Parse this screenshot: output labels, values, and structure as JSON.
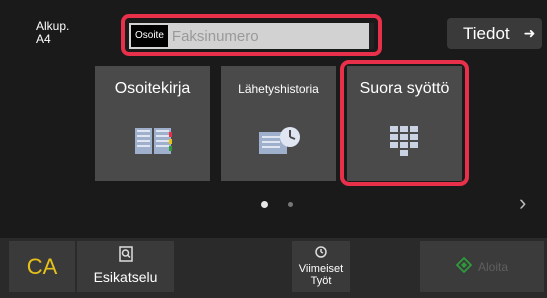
{
  "original": {
    "label": "Alkup.",
    "size": "A4"
  },
  "address": {
    "tag": "Osoite",
    "placeholder": "Faksinumero"
  },
  "info_button": {
    "label": "Tiedot",
    "icon": "arrow-right-icon"
  },
  "tiles": [
    {
      "label": "Osoitekirja",
      "icon": "address-book-icon"
    },
    {
      "label": "Lähetyshistoria",
      "icon": "history-list-icon"
    },
    {
      "label": "Suora syöttö",
      "icon": "keypad-icon"
    }
  ],
  "pager": {
    "page": 1,
    "total": 2,
    "next_icon": "chevron-right-icon"
  },
  "bottom": {
    "ca": "CA",
    "preview": "Esikatselu",
    "recent_line1": "Viimeiset",
    "recent_line2": "Työt",
    "start": "Aloita"
  },
  "colors": {
    "highlight": "#e8304a",
    "ca": "#e6c11a",
    "start_icon": "#2e9a3c"
  }
}
